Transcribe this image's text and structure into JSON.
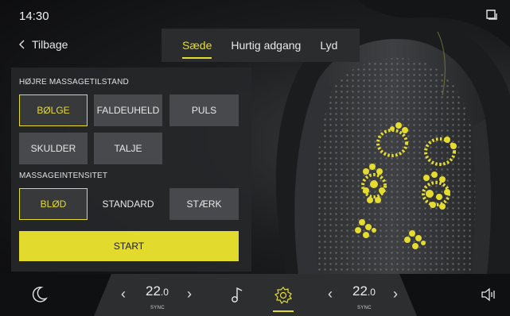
{
  "status": {
    "time": "14:30",
    "status_icon": "car-status-icon"
  },
  "nav": {
    "back_label": "Tilbage",
    "back_icon": "chevron-left-icon"
  },
  "tabs": [
    {
      "label": "Sæde",
      "active": true
    },
    {
      "label": "Hurtig adgang",
      "active": false
    },
    {
      "label": "Lyd",
      "active": false
    }
  ],
  "massage_mode": {
    "title": "HØJRE MASSAGETILSTAND",
    "options": [
      {
        "label": "BØLGE",
        "selected": true
      },
      {
        "label": "FALDEUHELD",
        "selected": false
      },
      {
        "label": "PULS",
        "selected": false
      },
      {
        "label": "SKULDER",
        "selected": false
      },
      {
        "label": "TALJE",
        "selected": false
      }
    ]
  },
  "massage_intensity": {
    "title": "MASSAGEINTENSITET",
    "options": [
      {
        "label": "BLØD",
        "selected": true
      },
      {
        "label": "STANDARD",
        "selected": false
      },
      {
        "label": "STÆRK",
        "selected": false
      }
    ]
  },
  "start_label": "START",
  "climate": {
    "left": {
      "temp": "22",
      "decimal": ".0",
      "label": "SYNC"
    },
    "right": {
      "temp": "22",
      "decimal": ".0",
      "label": "SYNC"
    }
  },
  "bottom_icons": [
    "moon-icon",
    "music-note-icon",
    "settings-gear-icon",
    "volume-icon"
  ],
  "colors": {
    "accent": "#e5dc2e",
    "panel": "#262729",
    "button": "#47494c"
  }
}
